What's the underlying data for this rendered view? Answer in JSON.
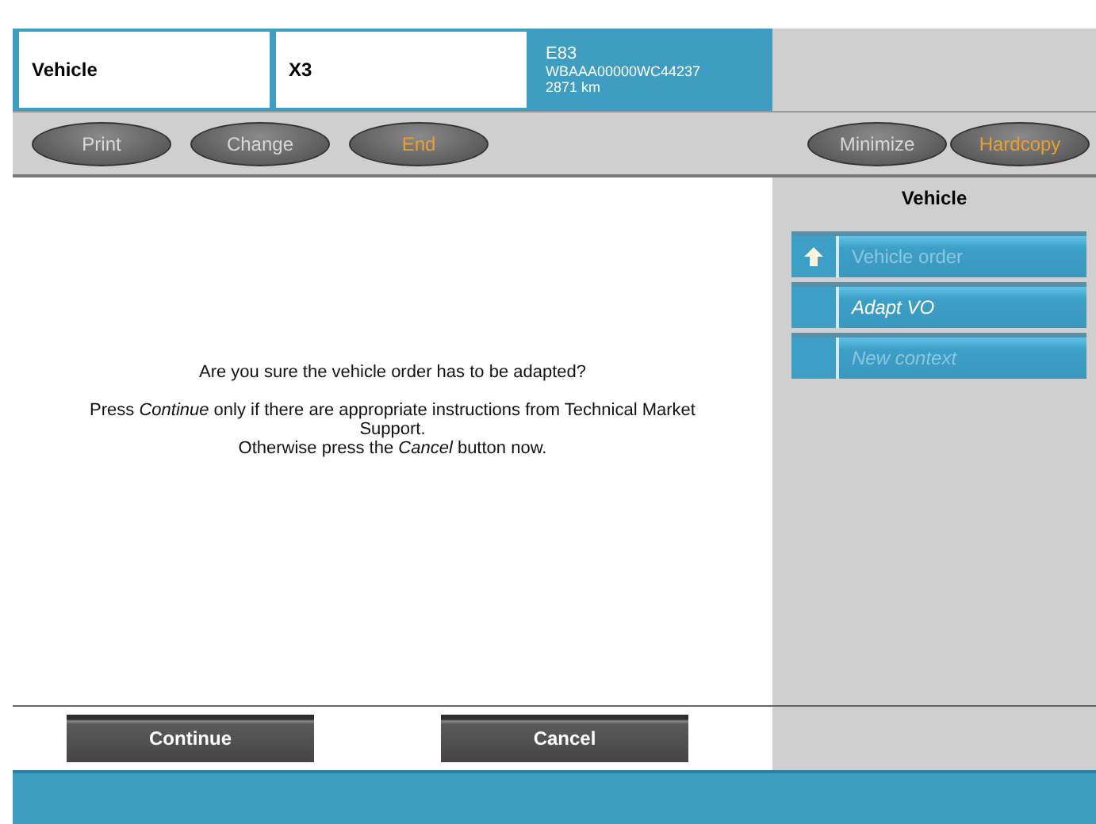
{
  "header": {
    "fields": [
      "Vehicle",
      "X3"
    ],
    "vehicle_info": [
      "E83",
      "WBAAA00000WC44237",
      "2871 km"
    ]
  },
  "toolbar": {
    "left": [
      {
        "label": "Print",
        "highlighted": false
      },
      {
        "label": "Change",
        "highlighted": false
      },
      {
        "label": "End",
        "highlighted": true
      }
    ],
    "right": [
      {
        "label": "Minimize",
        "highlighted": false
      },
      {
        "label": "Hardcopy",
        "highlighted": true
      }
    ]
  },
  "dialog": {
    "question": "Are you sure the vehicle order has to be adapted?",
    "instructions": [
      "Press *Continue* only if there are appropriate instructions from Technical Market Support.",
      "Otherwise press the *Cancel* button now."
    ]
  },
  "sidebar": {
    "title": "Vehicle",
    "items": [
      {
        "label": "Vehicle order",
        "kind": "back",
        "disabled": true
      },
      {
        "label": "Adapt VO",
        "kind": "node",
        "disabled": false
      },
      {
        "label": "New context",
        "kind": "node",
        "disabled": true
      }
    ]
  },
  "buttons": [
    "Continue",
    "Cancel"
  ]
}
